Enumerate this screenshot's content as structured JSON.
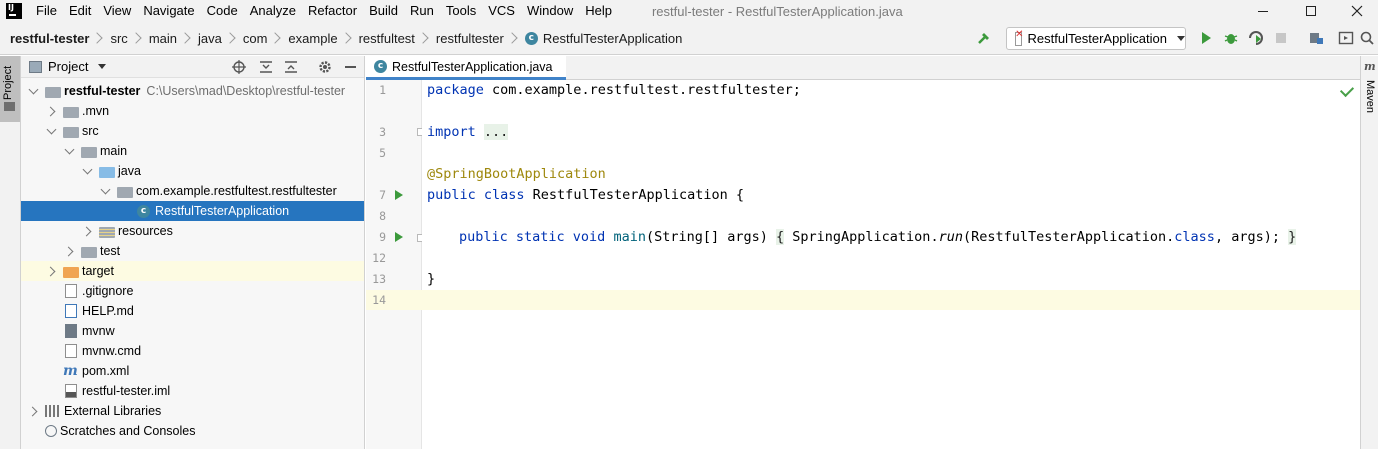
{
  "menubar": {
    "items": [
      "File",
      "Edit",
      "View",
      "Navigate",
      "Code",
      "Analyze",
      "Refactor",
      "Build",
      "Run",
      "Tools",
      "VCS",
      "Window",
      "Help"
    ],
    "window_title": "restful-tester - RestfulTesterApplication.java"
  },
  "breadcrumb": [
    "restful-tester",
    "src",
    "main",
    "java",
    "com",
    "example",
    "restfultest",
    "restfultester",
    "RestfulTesterApplication"
  ],
  "toolbar": {
    "run_config": "RestfulTesterApplication"
  },
  "left_strip": {
    "project_tab": "Project"
  },
  "right_strip": {
    "maven_tab": "Maven"
  },
  "project_panel": {
    "title": "Project",
    "root_path": "C:\\Users\\mad\\Desktop\\restful-tester",
    "tree": [
      {
        "label": "restful-tester",
        "depth": 0,
        "arrow": "down",
        "icon": "module-folder-icon"
      },
      {
        "label": ".mvn",
        "depth": 1,
        "arrow": "right",
        "icon": "folder-icon"
      },
      {
        "label": "src",
        "depth": 1,
        "arrow": "down",
        "icon": "folder-icon"
      },
      {
        "label": "main",
        "depth": 2,
        "arrow": "down",
        "icon": "folder-icon"
      },
      {
        "label": "java",
        "depth": 3,
        "arrow": "down",
        "icon": "source-folder-icon"
      },
      {
        "label": "com.example.restfultest.restfultester",
        "depth": 4,
        "arrow": "down",
        "icon": "package-icon"
      },
      {
        "label": "RestfulTesterApplication",
        "depth": 5,
        "arrow": "none",
        "icon": "spring-class-icon"
      },
      {
        "label": "resources",
        "depth": 3,
        "arrow": "right",
        "icon": "resources-folder-icon"
      },
      {
        "label": "test",
        "depth": 2,
        "arrow": "right",
        "icon": "folder-icon"
      },
      {
        "label": "target",
        "depth": 1,
        "arrow": "right",
        "icon": "excluded-folder-icon"
      },
      {
        "label": ".gitignore",
        "depth": 1,
        "arrow": "none",
        "icon": "gitignore-file-icon"
      },
      {
        "label": "HELP.md",
        "depth": 1,
        "arrow": "none",
        "icon": "markdown-file-icon"
      },
      {
        "label": "mvnw",
        "depth": 1,
        "arrow": "none",
        "icon": "shell-file-icon"
      },
      {
        "label": "mvnw.cmd",
        "depth": 1,
        "arrow": "none",
        "icon": "text-file-icon"
      },
      {
        "label": "pom.xml",
        "depth": 1,
        "arrow": "none",
        "icon": "maven-file-icon"
      },
      {
        "label": "restful-tester.iml",
        "depth": 1,
        "arrow": "none",
        "icon": "iml-file-icon"
      },
      {
        "label": "External Libraries",
        "depth": 0,
        "arrow": "right",
        "icon": "libraries-icon"
      },
      {
        "label": "Scratches and Consoles",
        "depth": 0,
        "arrow": "none",
        "icon": "scratches-icon"
      }
    ]
  },
  "editor": {
    "tab_label": "RestfulTesterApplication.java",
    "line_numbers": [
      "1",
      "3",
      "5",
      "7",
      "8",
      "9",
      "12",
      "13",
      "14"
    ],
    "lines": {
      "l1_kw": "package",
      "l1_rest": " com.example.restfultest.restfultester;",
      "l3_kw": "import",
      "l3_fold": "...",
      "l5_ann": "@SpringBootApplication",
      "l7_kw": "public class",
      "l7_rest": " RestfulTesterApplication {",
      "l9_kw1": "public static void",
      "l9_name": " main",
      "l9_args": "(String[] args) ",
      "l9_fold_open": "{",
      "l9_body1": " SpringApplication.",
      "l9_run": "run",
      "l9_body2": "(RestfulTesterApplication.",
      "l9_class": "class",
      "l9_body3": ", args); ",
      "l9_fold_close": "}",
      "l13": "}"
    }
  }
}
